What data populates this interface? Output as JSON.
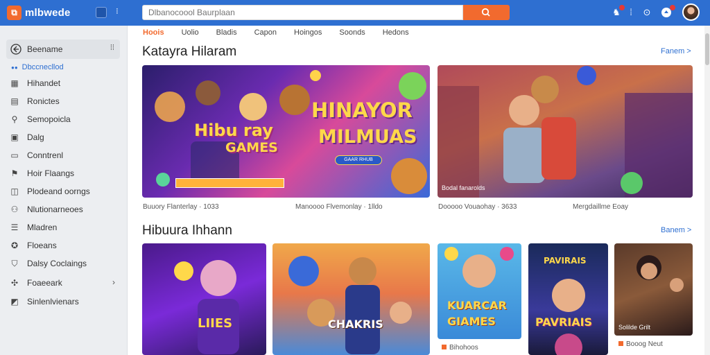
{
  "header": {
    "brand": "mlbwede",
    "search_placeholder": "Dlbanocoool Baurplaan",
    "notifications_badge_color": "#e53935"
  },
  "sidebar": {
    "home_label": "Beename",
    "sub_label": "Dbccnecllod",
    "items": [
      {
        "label": "Hihandet",
        "icon": "grid-icon"
      },
      {
        "label": "Ronictes",
        "icon": "document-icon"
      },
      {
        "label": "Semopoicla",
        "icon": "search-icon"
      },
      {
        "label": "Dalg",
        "icon": "chart-icon"
      },
      {
        "label": "Conntrenl",
        "icon": "folder-icon"
      },
      {
        "label": "Hoir Flaangs",
        "icon": "flag-icon"
      },
      {
        "label": "Plodeand oorngs",
        "icon": "controller-icon"
      },
      {
        "label": "Nlutionarneoes",
        "icon": "people-icon"
      },
      {
        "label": "Mladren",
        "icon": "list-icon"
      },
      {
        "label": "Floeans",
        "icon": "star-icon"
      },
      {
        "label": "Dalsy Coclaings",
        "icon": "shield-icon"
      },
      {
        "label": "Foaeeark",
        "icon": "settings-icon"
      },
      {
        "label": "Sinlenlvienars",
        "icon": "tag-icon"
      }
    ]
  },
  "tabs": [
    "Hoois",
    "Uolio",
    "Bladis",
    "Capon",
    "Hoingos",
    "Soonds",
    "Hedons"
  ],
  "sections": [
    {
      "title": "Katayra Hilaram",
      "see_all": "Fanem >",
      "cards": [
        {
          "banner_line1": "Hibu ray",
          "banner_line2": "GAMES",
          "big_line1": "HINAYOR",
          "big_line2": "MILMUAS",
          "small_btn": "GAAR RHUB",
          "caption_left": "Buuory Flanterlay · 1033",
          "caption_right": "Manoooo Flvemonlay · 1lldo"
        },
        {
          "overlay": "Bodal fanarolds",
          "caption_left": "Dooooo Vouaohay · 3633",
          "caption_right": "Mergdaillme Eoay"
        }
      ]
    },
    {
      "title": "Hibuura Ihhann",
      "see_all": "Banem >",
      "cards": [
        {
          "text": "LIIES"
        },
        {
          "text": "CHAKRIS"
        },
        {
          "text_line1": "KUARCAR",
          "text_line2": "GIAMES",
          "caption": "Bihohoos"
        },
        {
          "text": "PAVRIAIS",
          "text_top": "PAVIRAIS"
        },
        {
          "overlay": "Solilde Grilt",
          "caption": "Booog Neut"
        }
      ]
    }
  ]
}
